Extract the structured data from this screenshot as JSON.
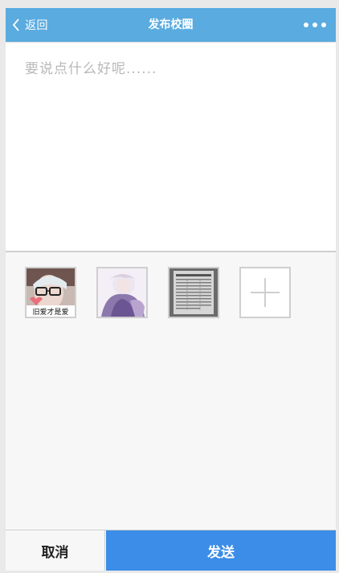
{
  "header": {
    "back_label": "返回",
    "title": "发布校圈",
    "more_icon": "more-dots-icon"
  },
  "compose": {
    "placeholder": "要说点什么好呢......",
    "value": ""
  },
  "photos": [
    {
      "name": "photo-selfie-glasses",
      "caption": "旧爱才是爱"
    },
    {
      "name": "photo-anime-character"
    },
    {
      "name": "photo-document-scan"
    }
  ],
  "add_photo_icon": "plus-icon",
  "footer": {
    "cancel_label": "取消",
    "send_label": "发送"
  },
  "colors": {
    "header_bg": "#5aabdf",
    "send_bg": "#3b8de8",
    "page_bg": "#f7f7f7"
  }
}
